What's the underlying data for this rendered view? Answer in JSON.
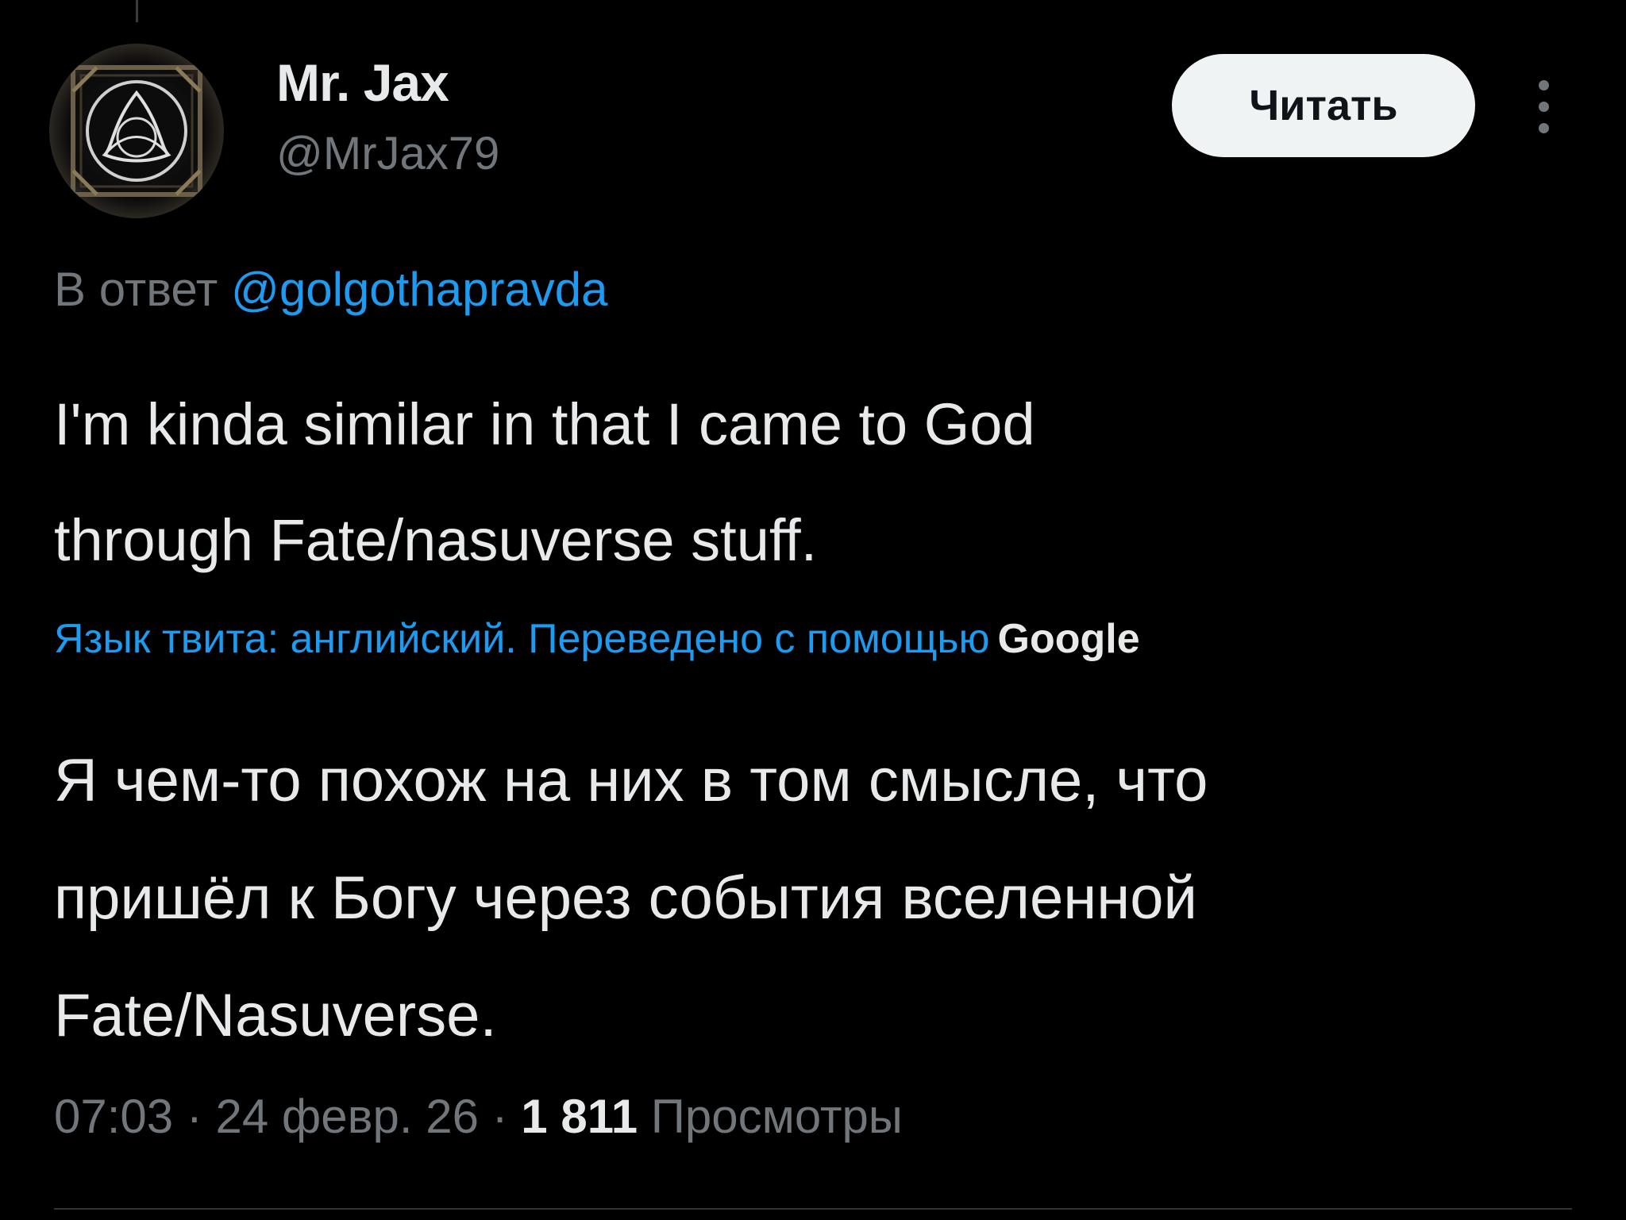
{
  "tweet": {
    "author": {
      "display_name": "Mr. Jax",
      "handle": "@MrJax79",
      "avatar_icon": "triquetra-emblem-icon"
    },
    "follow_label": "Читать",
    "more_icon": "more-vertical-icon",
    "reply_prefix": "В ответ",
    "reply_to": "@golgothapravda",
    "text_lines": [
      "I'm kinda similar in that I came to God",
      "through Fate/nasuverse stuff."
    ],
    "translation": {
      "note": "Язык твита: английский. Переведено с помощью",
      "provider": "Google",
      "text_lines": [
        "Я чем-то похож на них в том смысле, что",
        "пришёл к Богу через события вселенной",
        "Fate/Nasuverse."
      ]
    },
    "meta": {
      "time": "07:03",
      "separator": " · ",
      "date": "24 февр. 26",
      "views_count": "1 811",
      "views_label": "Просмотры"
    }
  },
  "colors": {
    "background": "#000000",
    "text_primary": "#e7e9ea",
    "text_secondary": "#71767b",
    "accent": "#1d9bf0",
    "button_bg": "#eff3f4"
  }
}
